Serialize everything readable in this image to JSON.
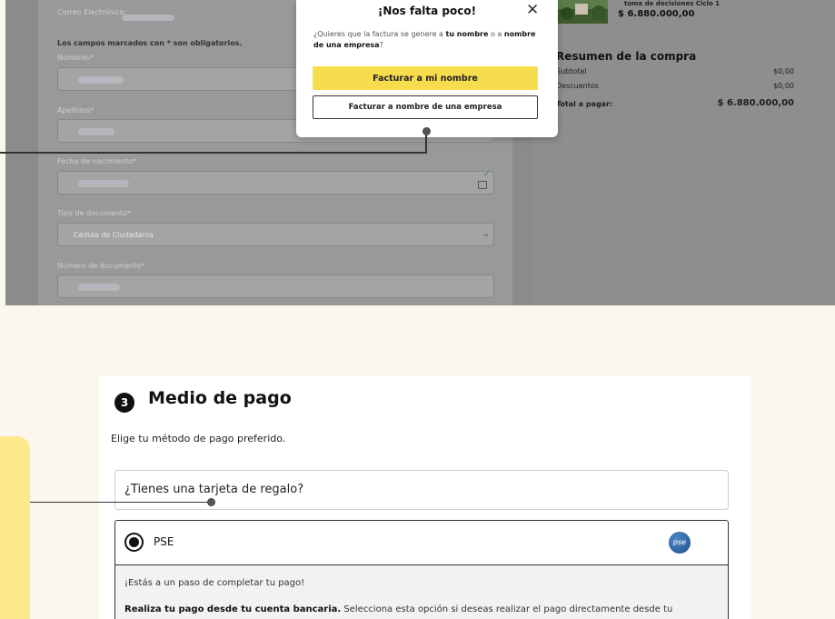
{
  "form": {
    "email_label": "Correo Electrónico:",
    "required_note": "Los campos marcados con * son obligatorios.",
    "names_label": "Nombres*",
    "surnames_label": "Apellidos*",
    "birthdate_label": "Fecha de nacimiento*",
    "doctype_label": "Tipo de documento*",
    "doctype_value": "Cédula de Ciudadanía",
    "docnumber_label": "Número de documento*"
  },
  "popup": {
    "title": "¡Nos falta poco!",
    "text_pre": "¿Quieres que la factura se genere a ",
    "text_bold1": "tu nombre",
    "text_mid": " o a ",
    "text_bold2": "nombre de una empresa",
    "text_end": "?",
    "btn_primary": "Facturar a mi nombre",
    "btn_secondary": "Facturar a nombre de una empresa"
  },
  "cart": {
    "product_name": "toma de decisiones Ciclo 1",
    "product_price": "$ 6.880.000,00"
  },
  "summary": {
    "title": "Resumen de la compra",
    "subtotal_label": "Subtotal",
    "subtotal_value": "$0,00",
    "discounts_label": "Descuentos",
    "discounts_value": "$0,00",
    "total_label": "Total a pagar:",
    "total_value": "$ 6.880.000,00"
  },
  "payment": {
    "step_number": "3",
    "title": "Medio de pago",
    "subtitle": "Elige tu método de pago preferido.",
    "gift_card_label": "¿Tienes una tarjeta de regalo?",
    "pse_label": "PSE",
    "pse_logo_text": "pse",
    "pse_line1": "¡Estás a un paso de completar tu pago!",
    "pse_line2_bold": "Realiza tu pago desde tu cuenta bancaria.",
    "pse_line2_rest": " Selecciona esta opción si deseas realizar el pago directamente desde tu"
  },
  "colors": {
    "accent_yellow": "#f7dc4d",
    "tab_yellow": "#fde98b",
    "page_bg": "#fbf7ef"
  }
}
